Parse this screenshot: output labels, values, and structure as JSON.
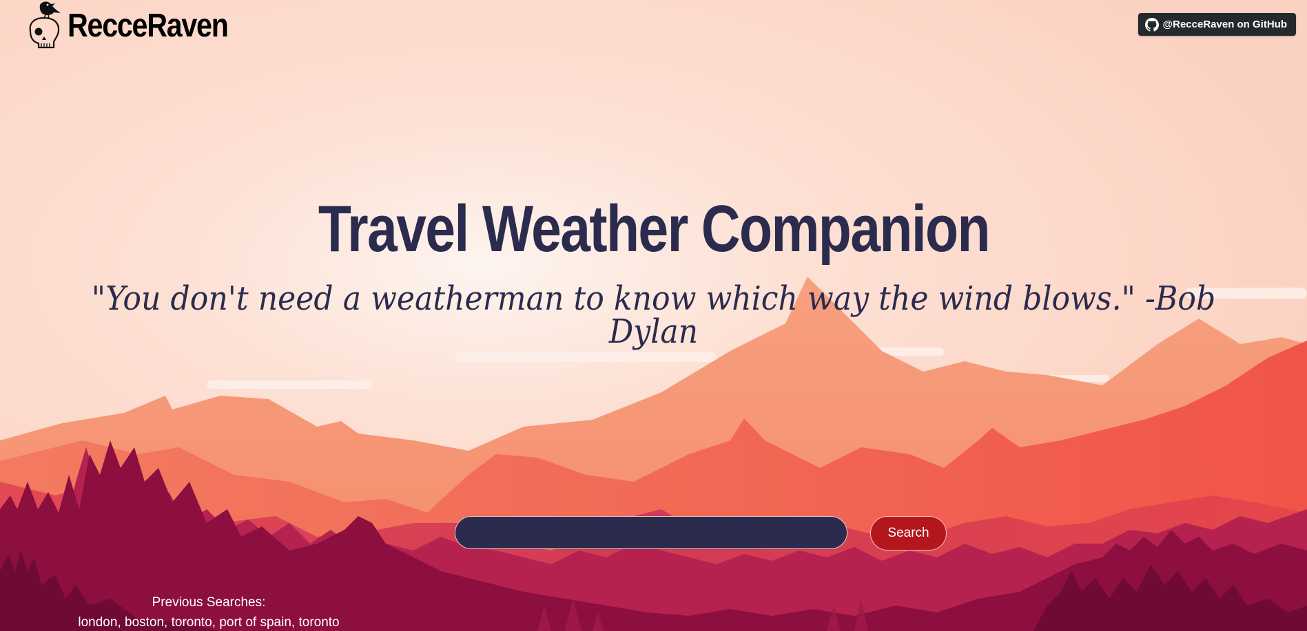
{
  "brand": {
    "name": "RecceRaven",
    "logo_icon": "skull-raven-icon"
  },
  "github": {
    "label": "@RecceRaven on GitHub",
    "icon": "github-icon",
    "bg_color": "#24292e"
  },
  "hero": {
    "title": "Travel Weather Companion",
    "quote": "\"You don't need a weatherman to know which way the wind blows.\" -Bob Dylan",
    "text_color": "#2b2b4d"
  },
  "search": {
    "input_value": "",
    "input_placeholder": "",
    "button_label": "Search",
    "input_color": "#2b2b4d",
    "button_color": "#b3171c"
  },
  "previous_searches": {
    "heading": "Previous Searches:",
    "items": [
      "london",
      "boston",
      "toronto",
      "port of spain",
      "toronto"
    ]
  },
  "colors": {
    "sky": "#fcd9cb",
    "mountain_light": "#f5876a",
    "mountain_mid": "#ef5a4a",
    "forest_dark": "#8c0f3f"
  }
}
